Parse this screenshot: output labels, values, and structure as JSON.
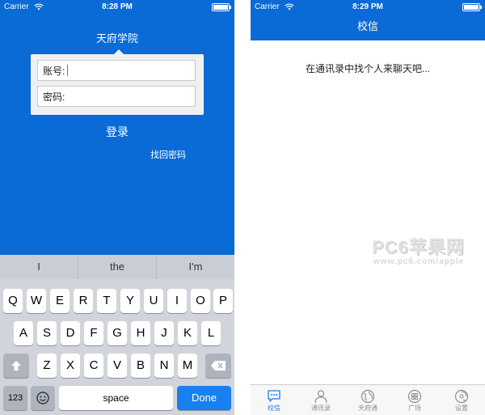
{
  "left_screen": {
    "status": {
      "carrier": "Carrier",
      "time": "8:28 PM"
    },
    "school_name": "天府学院",
    "account_label": "账号:",
    "password_label": "密码:",
    "login_button": "登录",
    "forgot_password": "找回密码",
    "keyboard": {
      "suggestions": [
        "I",
        "the",
        "I'm"
      ],
      "row1": [
        "Q",
        "W",
        "E",
        "R",
        "T",
        "Y",
        "U",
        "I",
        "O",
        "P"
      ],
      "row2": [
        "A",
        "S",
        "D",
        "F",
        "G",
        "H",
        "J",
        "K",
        "L"
      ],
      "row3": [
        "Z",
        "X",
        "C",
        "V",
        "B",
        "N",
        "M"
      ],
      "numbers_key": "123",
      "space_key": "space",
      "done_key": "Done"
    }
  },
  "right_screen": {
    "status": {
      "carrier": "Carrier",
      "time": "8:29 PM"
    },
    "title": "校信",
    "empty_hint": "在通讯录中找个人来聊天吧...",
    "tabs": [
      {
        "label": "校信",
        "icon": "chat-bubble-icon"
      },
      {
        "label": "通讯录",
        "icon": "person-icon"
      },
      {
        "label": "天府通",
        "icon": "globe-icon"
      },
      {
        "label": "广场",
        "icon": "grid-icon"
      },
      {
        "label": "设置",
        "icon": "disc-icon"
      }
    ],
    "active_tab": 0
  },
  "watermark": {
    "brand": "PC6苹果网",
    "url": "www.pc6.com/apple"
  },
  "colors": {
    "brand_blue": "#0a6ad6",
    "active_tab": "#1a7ff0",
    "done_key": "#1a7ff0"
  }
}
